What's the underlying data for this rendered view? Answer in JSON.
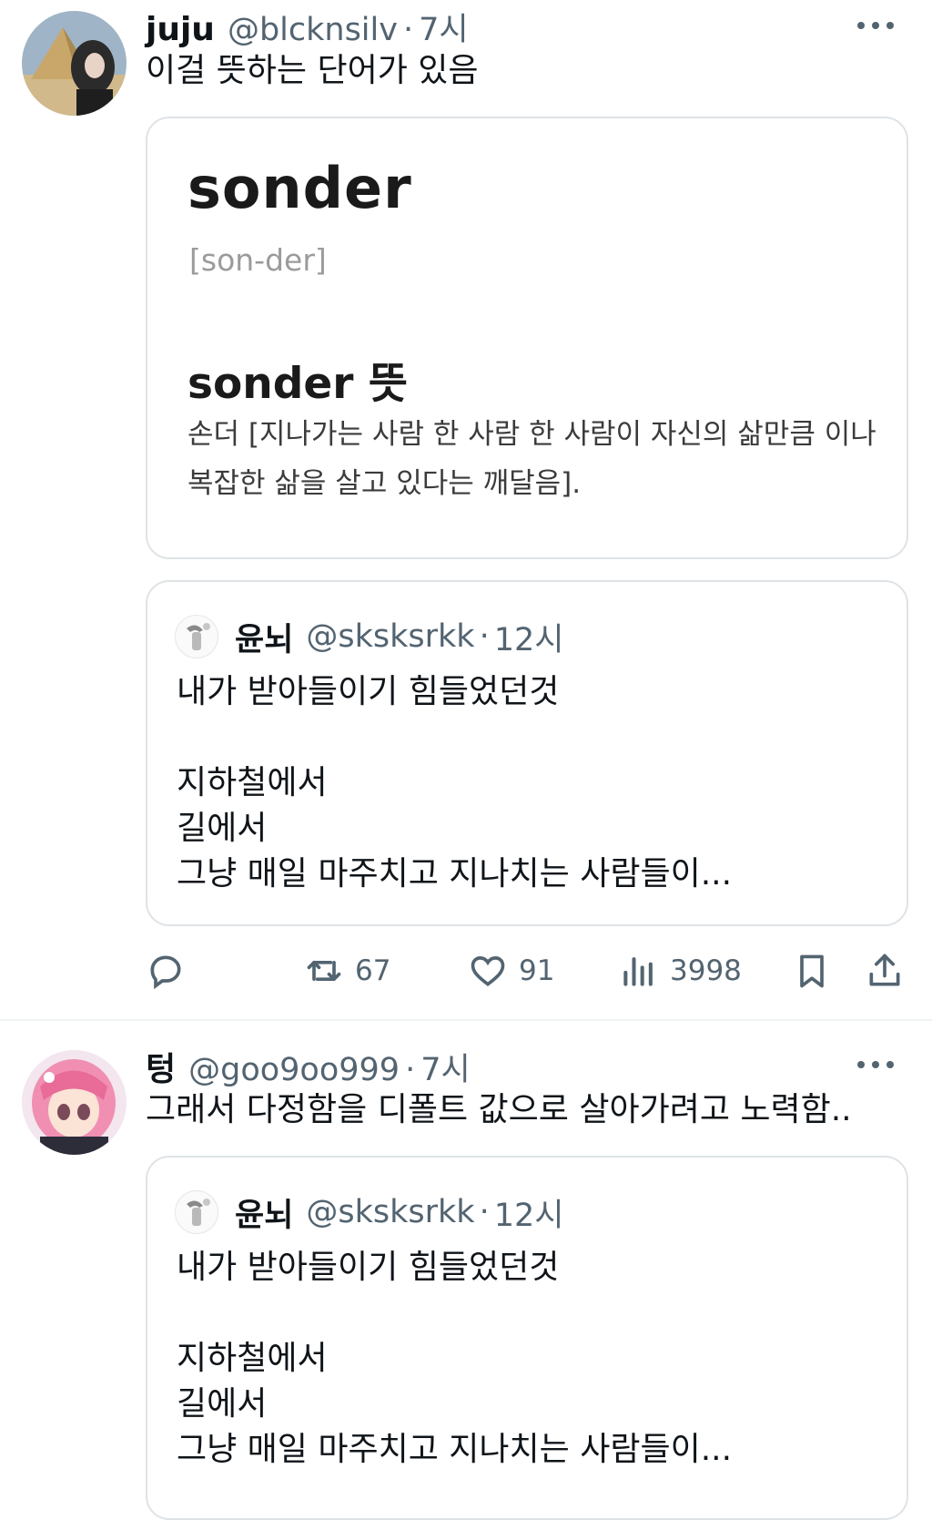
{
  "tweets": [
    {
      "author": {
        "name": "juju",
        "handle": "@blcknsilv",
        "time": "7시"
      },
      "text": "이걸 뜻하는 단어가 있음",
      "definition": {
        "word": "sonder",
        "pronunciation": "[son-der]",
        "heading": "sonder 뜻",
        "text": "손더 [지나가는 사람 한 사람 한 사람이 자신의 삶만큼 이나 복잡한 삶을 살고 있다는 깨달음]."
      },
      "quote": {
        "author": {
          "name": "윤뇌",
          "handle": "@sksksrkk",
          "time": "12시"
        },
        "lines": [
          "내가 받아들이기 힘들었던것",
          "",
          "지하철에서",
          "길에서",
          "그냥 매일 마주치고 지나치는 사람들이..."
        ]
      },
      "stats": {
        "retweets": "67",
        "likes": "91",
        "views": "3998"
      }
    },
    {
      "author": {
        "name": "텅",
        "handle": "@goo9oo999",
        "time": "7시"
      },
      "text": "그래서 다정함을 디폴트 값으로 살아가려고 노력함..",
      "quote": {
        "author": {
          "name": "윤뇌",
          "handle": "@sksksrkk",
          "time": "12시"
        },
        "lines": [
          "내가 받아들이기 힘들었던것",
          "",
          "지하철에서",
          "길에서",
          "그냥 매일 마주치고 지나치는 사람들이..."
        ]
      }
    }
  ],
  "separator": "·",
  "colors": {
    "text": "#0f1419",
    "secondary": "#536471",
    "border": "#dfe3e6",
    "divider": "#eff3f4"
  },
  "icons": [
    "more-icon",
    "reply-icon",
    "retweet-icon",
    "like-icon",
    "views-icon",
    "bookmark-icon",
    "share-icon"
  ]
}
